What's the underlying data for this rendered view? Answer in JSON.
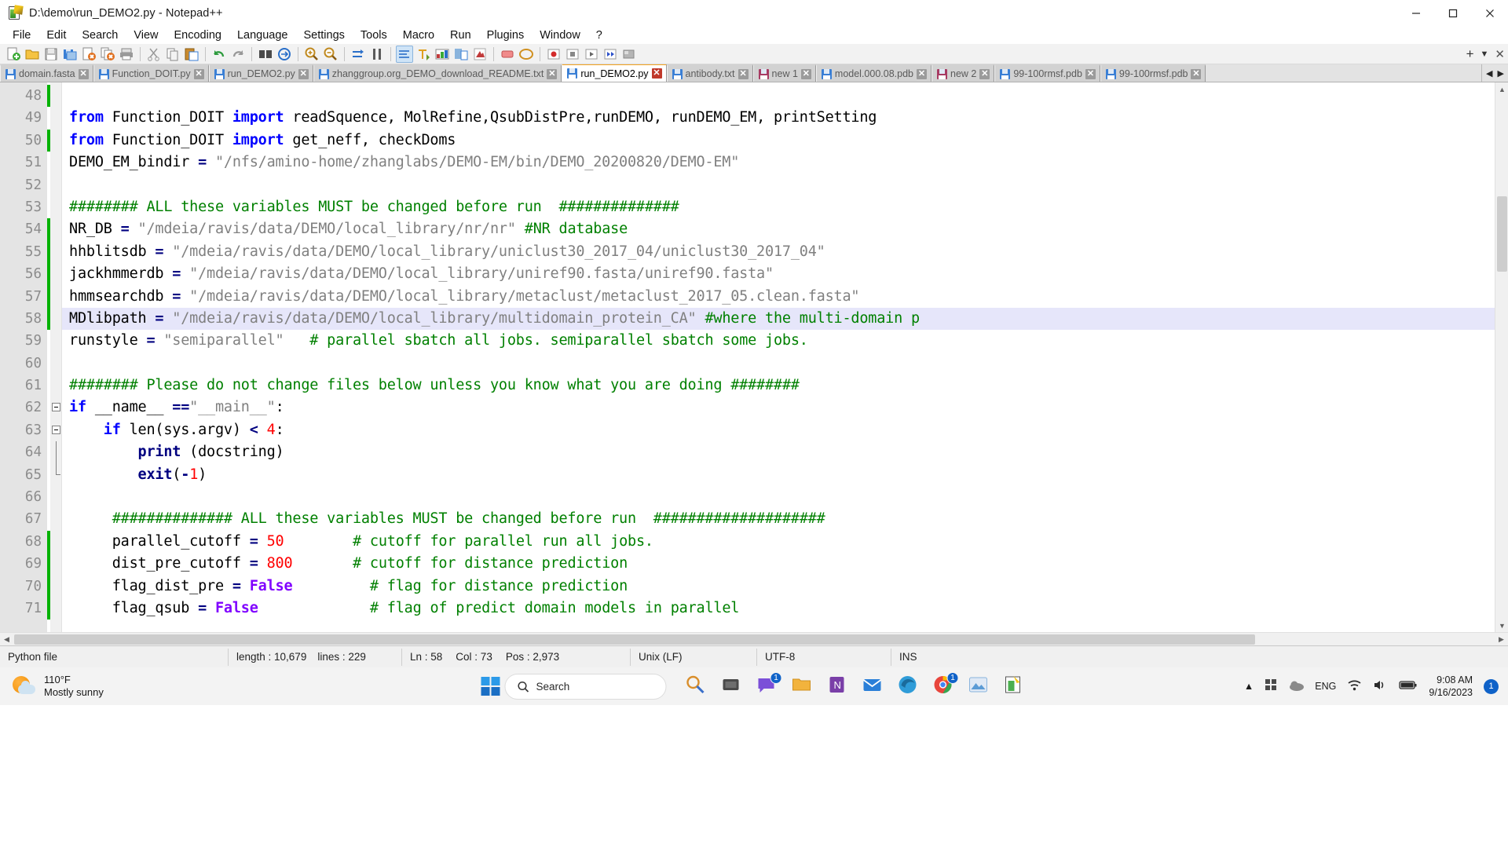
{
  "window": {
    "title": "D:\\demo\\run_DEMO2.py - Notepad++",
    "icon": "notepad-plus-plus-icon",
    "minimize": "minimize",
    "maximize": "maximize",
    "close": "close"
  },
  "menu": [
    "File",
    "Edit",
    "Search",
    "View",
    "Encoding",
    "Language",
    "Settings",
    "Tools",
    "Macro",
    "Run",
    "Plugins",
    "Window",
    "?"
  ],
  "toolbar_right": {
    "plus": "+",
    "chevron": "▼",
    "close": "✕"
  },
  "tabs": [
    {
      "label": "domain.fasta",
      "active": false,
      "color": "blue"
    },
    {
      "label": "Function_DOIT.py",
      "active": false,
      "color": "blue"
    },
    {
      "label": "run_DEMO2.py",
      "active": false,
      "color": "blue"
    },
    {
      "label": "zhanggroup.org_DEMO_download_README.txt",
      "active": false,
      "color": "blue"
    },
    {
      "label": "run_DEMO2.py",
      "active": true,
      "color": "blue"
    },
    {
      "label": "antibody.txt",
      "active": false,
      "color": "blue"
    },
    {
      "label": "new 1",
      "active": false,
      "color": "red"
    },
    {
      "label": "model.000.08.pdb",
      "active": false,
      "color": "blue"
    },
    {
      "label": "new 2",
      "active": false,
      "color": "red"
    },
    {
      "label": "99-100rmsf.pdb",
      "active": false,
      "color": "blue"
    },
    {
      "label": "99-100rmsf.pdb",
      "active": false,
      "color": "blue"
    }
  ],
  "tab_scroll": {
    "left": "◀",
    "right": "▶"
  },
  "editor": {
    "first_line": 48,
    "current_line": 58,
    "lines": [
      {
        "n": 48,
        "change": true,
        "fold": "none",
        "tokens": []
      },
      {
        "n": 49,
        "change": false,
        "fold": "none",
        "tokens": [
          {
            "t": "from",
            "c": "kw"
          },
          {
            "t": " Function_DOIT ",
            "c": ""
          },
          {
            "t": "import",
            "c": "kw"
          },
          {
            "t": " readSquence, MolRefine,QsubDistPre,runDEMO, runDEMO_EM, printSetting",
            "c": ""
          }
        ]
      },
      {
        "n": 50,
        "change": true,
        "fold": "none",
        "tokens": [
          {
            "t": "from",
            "c": "kw"
          },
          {
            "t": " Function_DOIT ",
            "c": ""
          },
          {
            "t": "import",
            "c": "kw"
          },
          {
            "t": " get_neff, checkDoms",
            "c": ""
          }
        ]
      },
      {
        "n": 51,
        "change": false,
        "fold": "none",
        "tokens": [
          {
            "t": "DEMO_EM_bindir ",
            "c": ""
          },
          {
            "t": "=",
            "c": "op"
          },
          {
            "t": " \"/nfs/amino-home/zhanglabs/DEMO-EM/bin/DEMO_20200820/DEMO-EM\"",
            "c": "str"
          }
        ]
      },
      {
        "n": 52,
        "change": false,
        "fold": "none",
        "tokens": []
      },
      {
        "n": 53,
        "change": false,
        "fold": "none",
        "tokens": [
          {
            "t": "######## ALL these variables MUST be changed before run  ##############",
            "c": "cmt"
          }
        ]
      },
      {
        "n": 54,
        "change": true,
        "fold": "none",
        "tokens": [
          {
            "t": "NR_DB ",
            "c": ""
          },
          {
            "t": "=",
            "c": "op"
          },
          {
            "t": " \"/mdeia/ravis/data/DEMO/local_library/nr/nr\" ",
            "c": "str"
          },
          {
            "t": "#NR database",
            "c": "cmt"
          }
        ]
      },
      {
        "n": 55,
        "change": true,
        "fold": "none",
        "tokens": [
          {
            "t": "hhblitsdb ",
            "c": ""
          },
          {
            "t": "=",
            "c": "op"
          },
          {
            "t": " \"/mdeia/ravis/data/DEMO/local_library/uniclust30_2017_04/uniclust30_2017_04\"",
            "c": "str"
          }
        ]
      },
      {
        "n": 56,
        "change": true,
        "fold": "none",
        "tokens": [
          {
            "t": "jackhmmerdb ",
            "c": ""
          },
          {
            "t": "=",
            "c": "op"
          },
          {
            "t": " \"/mdeia/ravis/data/DEMO/local_library/uniref90.fasta/uniref90.fasta\"",
            "c": "str"
          }
        ]
      },
      {
        "n": 57,
        "change": true,
        "fold": "none",
        "tokens": [
          {
            "t": "hmmsearchdb ",
            "c": ""
          },
          {
            "t": "=",
            "c": "op"
          },
          {
            "t": " \"/mdeia/ravis/data/DEMO/local_library/metaclust/metaclust_2017_05.clean.fasta\"",
            "c": "str"
          }
        ]
      },
      {
        "n": 58,
        "change": true,
        "fold": "none",
        "current": true,
        "tokens": [
          {
            "t": "MDlibpath ",
            "c": ""
          },
          {
            "t": "=",
            "c": "op"
          },
          {
            "t": " \"/mdeia/ravis/data/DEMO/local_library/multidomain_protein_CA\" ",
            "c": "str"
          },
          {
            "t": "#where the multi-domain p",
            "c": "cmt"
          }
        ]
      },
      {
        "n": 59,
        "change": false,
        "fold": "none",
        "tokens": [
          {
            "t": "runstyle ",
            "c": ""
          },
          {
            "t": "=",
            "c": "op"
          },
          {
            "t": " \"semiparallel\"",
            "c": "str"
          },
          {
            "t": "   # parallel sbatch all jobs. semiparallel sbatch some jobs.",
            "c": "cmt"
          }
        ]
      },
      {
        "n": 60,
        "change": false,
        "fold": "none",
        "tokens": []
      },
      {
        "n": 61,
        "change": false,
        "fold": "none",
        "tokens": [
          {
            "t": "######## Please do not change files below unless you know what you are doing ########",
            "c": "cmt"
          }
        ]
      },
      {
        "n": 62,
        "change": false,
        "fold": "open",
        "tokens": [
          {
            "t": "if",
            "c": "kw"
          },
          {
            "t": " __name__ ",
            "c": ""
          },
          {
            "t": "==",
            "c": "op"
          },
          {
            "t": "\"__main__\"",
            "c": "str"
          },
          {
            "t": ":",
            "c": ""
          }
        ]
      },
      {
        "n": 63,
        "change": false,
        "fold": "open2",
        "indent": 1,
        "tokens": [
          {
            "t": "    ",
            "c": ""
          },
          {
            "t": "if",
            "c": "kw"
          },
          {
            "t": " len",
            "c": ""
          },
          {
            "t": "(sys.argv) ",
            "c": ""
          },
          {
            "t": "<",
            "c": "op"
          },
          {
            "t": " ",
            "c": ""
          },
          {
            "t": "4",
            "c": "num"
          },
          {
            "t": ":",
            "c": ""
          }
        ]
      },
      {
        "n": 64,
        "change": false,
        "fold": "line",
        "tokens": [
          {
            "t": "        ",
            "c": ""
          },
          {
            "t": "print",
            "c": "fn"
          },
          {
            "t": " (docstring)",
            "c": ""
          }
        ]
      },
      {
        "n": 65,
        "change": false,
        "fold": "end",
        "tokens": [
          {
            "t": "        ",
            "c": ""
          },
          {
            "t": "exit",
            "c": "fn"
          },
          {
            "t": "(",
            "c": ""
          },
          {
            "t": "-",
            "c": "op"
          },
          {
            "t": "1",
            "c": "num"
          },
          {
            "t": ")",
            "c": ""
          }
        ]
      },
      {
        "n": 66,
        "change": false,
        "fold": "none",
        "tokens": []
      },
      {
        "n": 67,
        "change": false,
        "fold": "none",
        "tokens": [
          {
            "t": "     ############## ALL these variables MUST be changed before run  ####################",
            "c": "cmt"
          }
        ]
      },
      {
        "n": 68,
        "change": true,
        "fold": "none",
        "tokens": [
          {
            "t": "     parallel_cutoff ",
            "c": ""
          },
          {
            "t": "=",
            "c": "op"
          },
          {
            "t": " ",
            "c": ""
          },
          {
            "t": "50",
            "c": "num"
          },
          {
            "t": "        # cutoff for parallel run all jobs.",
            "c": "cmt"
          }
        ]
      },
      {
        "n": 69,
        "change": true,
        "fold": "none",
        "tokens": [
          {
            "t": "     dist_pre_cutoff ",
            "c": ""
          },
          {
            "t": "=",
            "c": "op"
          },
          {
            "t": " ",
            "c": ""
          },
          {
            "t": "800",
            "c": "num"
          },
          {
            "t": "       # cutoff for distance prediction",
            "c": "cmt"
          }
        ]
      },
      {
        "n": 70,
        "change": true,
        "fold": "none",
        "tokens": [
          {
            "t": "     flag_dist_pre ",
            "c": ""
          },
          {
            "t": "=",
            "c": "op"
          },
          {
            "t": " ",
            "c": ""
          },
          {
            "t": "False",
            "c": "bool"
          },
          {
            "t": "         # flag for distance prediction",
            "c": "cmt"
          }
        ]
      },
      {
        "n": 71,
        "change": true,
        "fold": "none",
        "tokens": [
          {
            "t": "     flag_qsub ",
            "c": ""
          },
          {
            "t": "=",
            "c": "op"
          },
          {
            "t": " ",
            "c": ""
          },
          {
            "t": "False",
            "c": "bool"
          },
          {
            "t": "             # flag of predict domain models in parallel",
            "c": "cmt"
          }
        ]
      }
    ]
  },
  "statusbar": {
    "filetype": "Python file",
    "length_label": "length : 10,679",
    "lines_label": "lines : 229",
    "ln": "Ln : 58",
    "col": "Col : 73",
    "pos": "Pos : 2,973",
    "eol": "Unix (LF)",
    "encoding": "UTF-8",
    "mode": "INS"
  },
  "taskbar": {
    "weather_temp": "110°F",
    "weather_desc": "Mostly sunny",
    "search_placeholder": "Search",
    "search_label": "Search",
    "notification_count": "1",
    "chat_badge": "1",
    "chrome_badge": "1",
    "language": "ENG",
    "time": "9:08 AM",
    "date": "9/16/2023"
  }
}
